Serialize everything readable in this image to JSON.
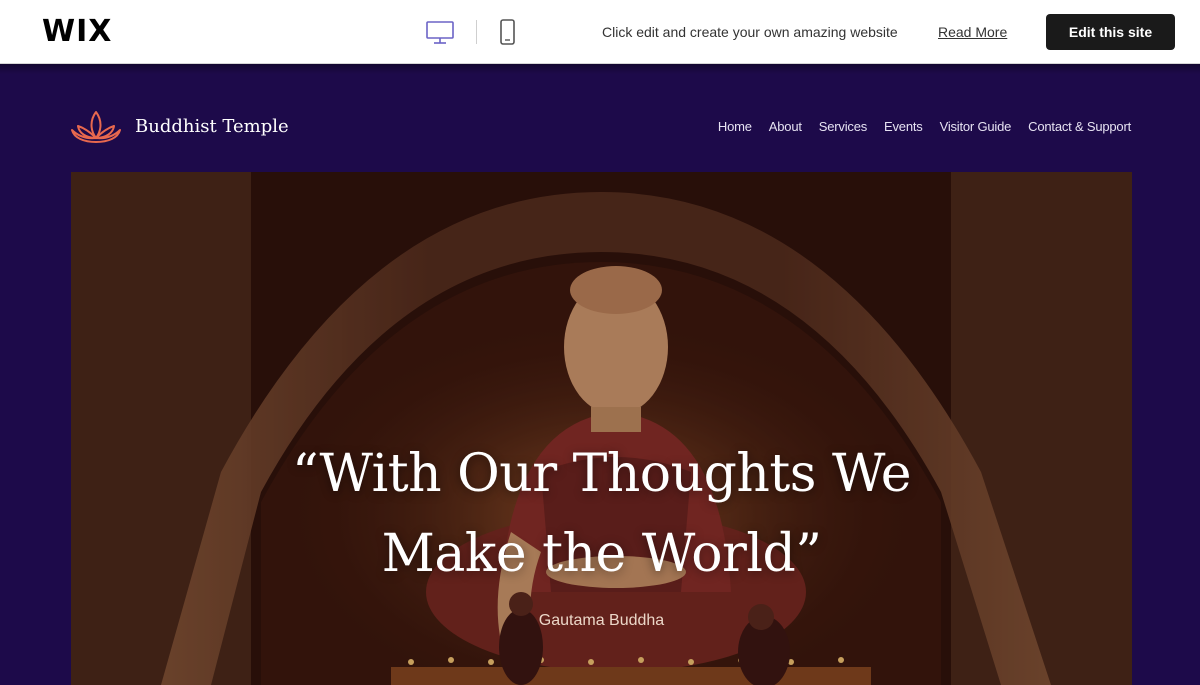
{
  "wix_bar": {
    "logo": "WIX",
    "promo_text": "Click edit and create your own amazing website",
    "read_more": "Read More",
    "edit_button": "Edit this site",
    "icons": {
      "desktop": "desktop-icon",
      "mobile": "mobile-icon"
    }
  },
  "site": {
    "title": "Buddhist Temple",
    "logo_icon": "lotus-icon",
    "nav": [
      "Home",
      "About",
      "Services",
      "Events",
      "Visitor Guide",
      "Contact & Support"
    ]
  },
  "hero": {
    "quote_line1": "“With Our Thoughts We",
    "quote_line2": "Make the World”",
    "author": "Gautama Buddha",
    "image": "buddha-statue-in-temple-photo"
  },
  "colors": {
    "site_background": "#1d0a4a",
    "lotus_accent": "#e8684e",
    "wix_button": "#1a1a1a"
  }
}
